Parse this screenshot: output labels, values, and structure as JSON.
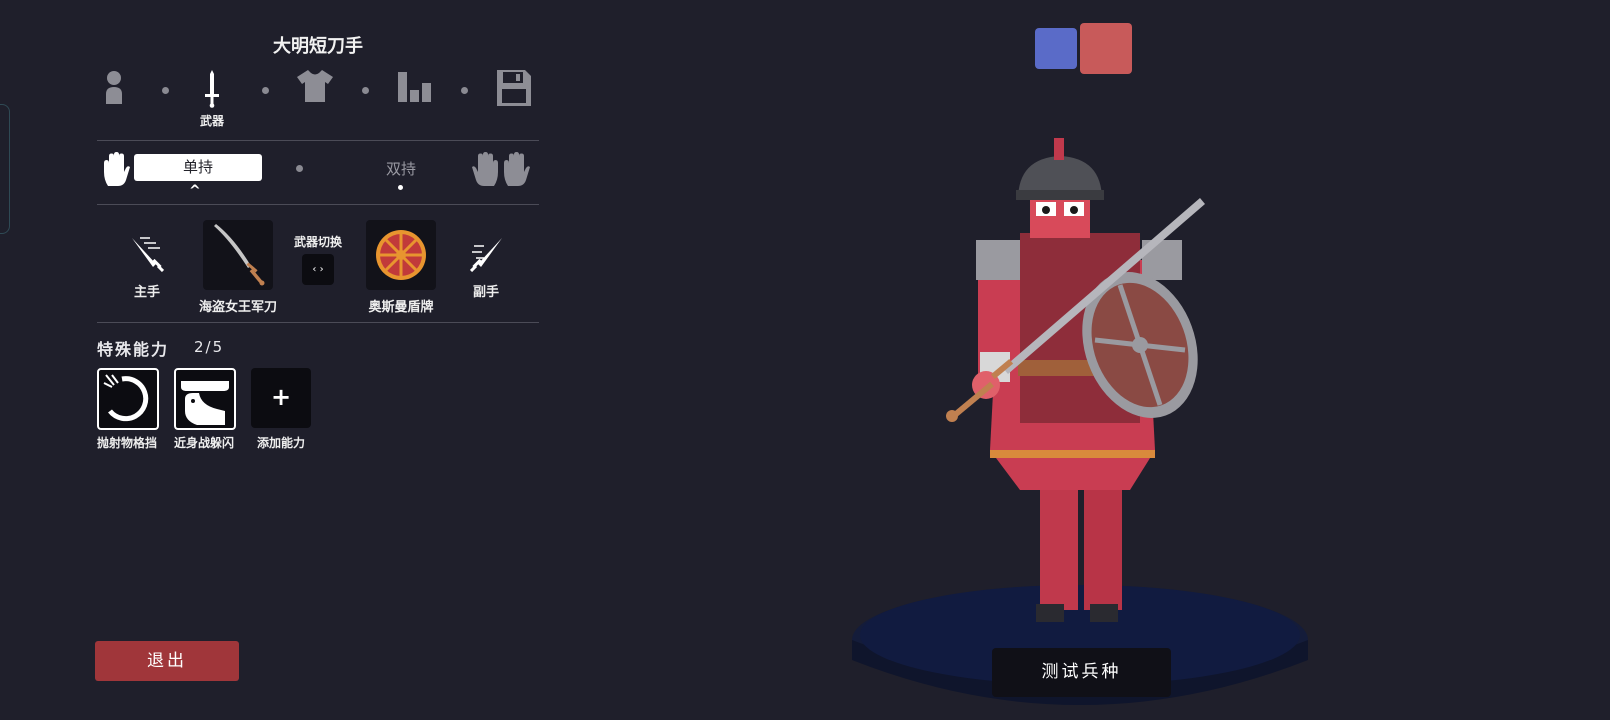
{
  "unit_name": "大明短刀手",
  "steps": [
    {
      "icon": "person-icon",
      "label": ""
    },
    {
      "icon": "sword-icon",
      "label": "武器"
    },
    {
      "icon": "shirt-icon",
      "label": ""
    },
    {
      "icon": "stats-icon",
      "label": ""
    },
    {
      "icon": "save-icon",
      "label": ""
    }
  ],
  "grip": {
    "single": "单持",
    "dual": "双持"
  },
  "weapons": {
    "main_hand_label": "主手",
    "off_hand_label": "副手",
    "main_weapon": "海盗女王军刀",
    "off_weapon": "奥斯曼盾牌",
    "swap_label": "武器切换",
    "swap_symbol": "‹ ›"
  },
  "abilities": {
    "title": "特殊能力",
    "count": "2/5",
    "items": [
      {
        "label": "抛射物格挡",
        "icon": "projectile-block-icon"
      },
      {
        "label": "近身战躲闪",
        "icon": "melee-dodge-icon"
      }
    ],
    "add_symbol": "+",
    "add_label": "添加能力"
  },
  "exit_label": "退出",
  "test_label": "测试兵种",
  "colors": {
    "background": "#1f1f2b",
    "team_blue": "#5a6bc8",
    "team_red": "#c85a5a",
    "exit": "#a0363a"
  }
}
